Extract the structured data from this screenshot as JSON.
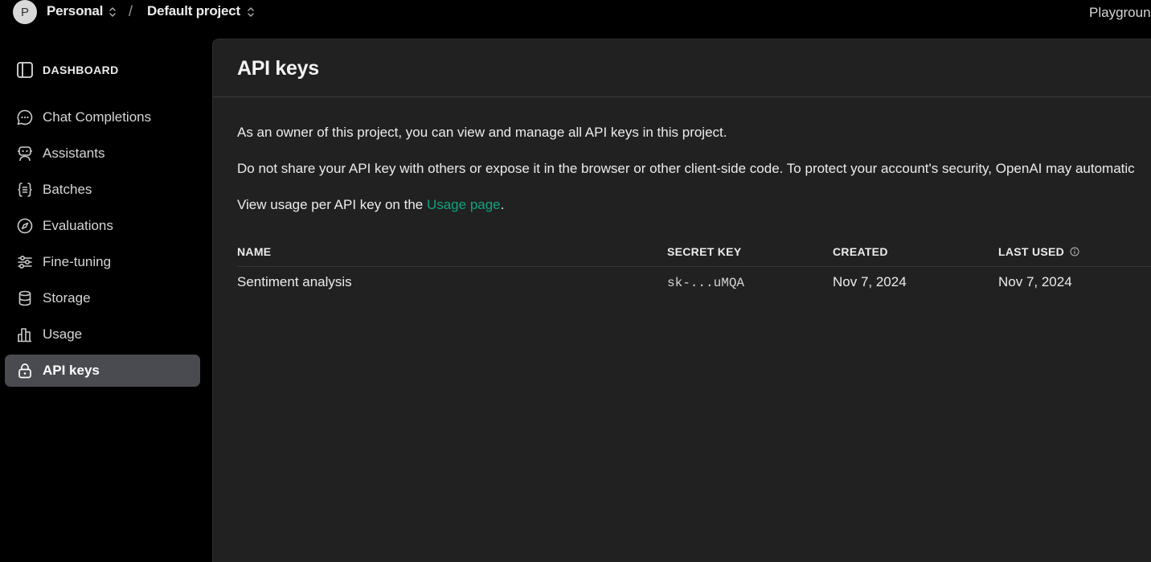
{
  "topbar": {
    "avatar_initial": "P",
    "org_name": "Personal",
    "project_name": "Default project",
    "right_link": "Playground"
  },
  "sidebar": {
    "section_title": "DASHBOARD",
    "items": [
      {
        "label": "Chat Completions",
        "icon": "chat-icon"
      },
      {
        "label": "Assistants",
        "icon": "robot-icon"
      },
      {
        "label": "Batches",
        "icon": "braces-icon"
      },
      {
        "label": "Evaluations",
        "icon": "compass-icon"
      },
      {
        "label": "Fine-tuning",
        "icon": "sliders-icon"
      },
      {
        "label": "Storage",
        "icon": "database-icon"
      },
      {
        "label": "Usage",
        "icon": "bar-chart-icon"
      },
      {
        "label": "API keys",
        "icon": "lock-icon",
        "active": true
      }
    ]
  },
  "main": {
    "title": "API keys",
    "para1": "As an owner of this project, you can view and manage all API keys in this project.",
    "para2": "Do not share your API key with others or expose it in the browser or other client-side code. To protect your account's security, OpenAI may automatic",
    "para3_prefix": "View usage per API key on the ",
    "para3_link": "Usage page",
    "para3_suffix": ".",
    "table": {
      "headers": {
        "name": "NAME",
        "secret": "SECRET KEY",
        "created": "CREATED",
        "last_used": "LAST USED"
      },
      "rows": [
        {
          "name": "Sentiment analysis",
          "secret": "sk-...uMQA",
          "created": "Nov 7, 2024",
          "last_used": "Nov 7, 2024"
        }
      ]
    }
  },
  "colors": {
    "accent_link": "#10a37f",
    "panel_bg": "#212121",
    "active_nav_bg": "#4a4b50"
  }
}
